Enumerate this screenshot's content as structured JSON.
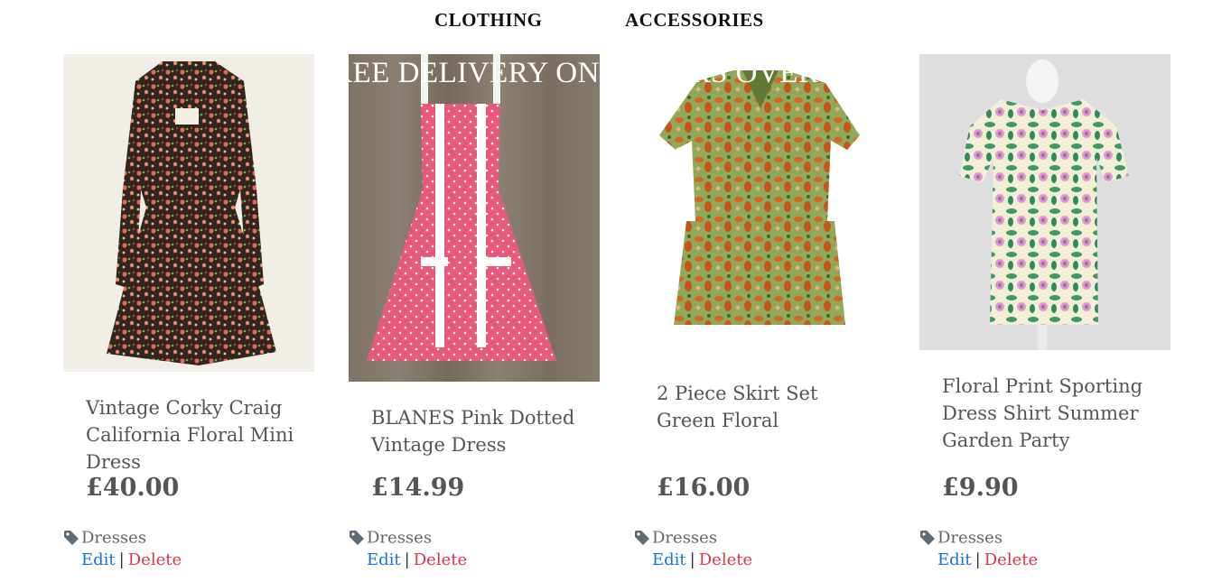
{
  "nav": {
    "clothing": "CLOTHING",
    "accessories": "ACCESSORIES"
  },
  "banner": {
    "text": "REE DELIVERY ON ORDERS OVER"
  },
  "products": [
    {
      "title": "Vintage Corky Craig California Floral Mini Dress",
      "price": "£40.00",
      "category": "Dresses",
      "edit_label": "Edit",
      "separator": "|",
      "delete_label": "Delete"
    },
    {
      "title": "BLANES Pink Dotted Vintage Dress",
      "price": "£14.99",
      "category": "Dresses",
      "edit_label": "Edit",
      "separator": "|",
      "delete_label": "Delete"
    },
    {
      "title": "2 Piece Skirt Set Green Floral",
      "price": "£16.00",
      "category": "Dresses",
      "edit_label": "Edit",
      "separator": "|",
      "delete_label": "Delete"
    },
    {
      "title": "Floral Print Sporting Dress Shirt Summer Garden Party",
      "price": "£9.90",
      "category": "Dresses",
      "edit_label": "Edit",
      "separator": "|",
      "delete_label": "Delete"
    }
  ],
  "colors": {
    "edit_link": "#1a73d9",
    "delete_link": "#dc3545",
    "text": "#555555",
    "nav_text": "#111111"
  },
  "icons": {
    "category": "tag-icon"
  }
}
